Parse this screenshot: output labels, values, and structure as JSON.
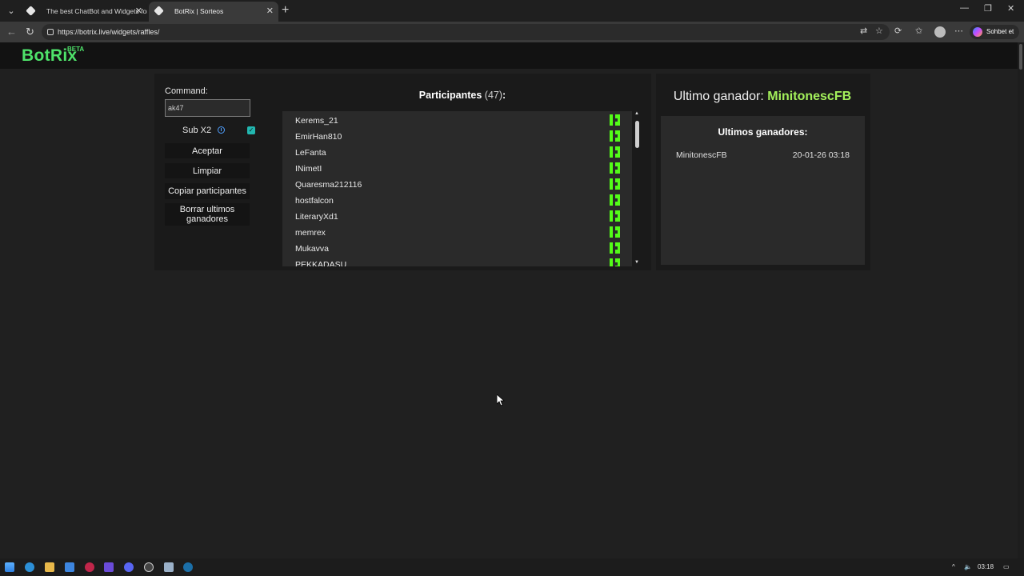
{
  "browser": {
    "tabs": [
      {
        "title": "The best ChatBot and Widgets for"
      },
      {
        "title": "BotRix | Sorteos"
      }
    ],
    "url": "https://botrix.live/widgets/raffles/",
    "copilot_label": "Sohbet et"
  },
  "site": {
    "logo": "BotRix",
    "logo_badge": "BETA"
  },
  "controls": {
    "command_label": "Command:",
    "command_value": "ak47",
    "sub_label": "Sub X2",
    "sub_checked": true,
    "accept": "Aceptar",
    "clear": "Limpiar",
    "copy": "Copiar participantes",
    "delete_winners": "Borrar ultimos ganadores"
  },
  "participants": {
    "title": "Participantes",
    "count": "(47)",
    "suffix": ":",
    "items": [
      "Kerems_21",
      "EmirHan810",
      "LeFanta",
      "INimetI",
      "Quaresma212116",
      "hostfalcon",
      "LiteraryXd1",
      "memrex",
      "Mukavva",
      "PEKKADASU"
    ],
    "platform_icon": "kick-icon",
    "platform_color": "#53fc18"
  },
  "winners": {
    "last_label": "Ultimo ganador:",
    "last_name": "MinitonescFB",
    "list_title": "Ultimos ganadores:",
    "list": [
      {
        "name": "MinitonescFB",
        "date": "20-01-26 03:18"
      }
    ]
  },
  "taskbar": {
    "time": "03:18"
  },
  "colors": {
    "brand": "#4ee36a",
    "winner": "#a3f05b",
    "checkbox": "#22b7b0"
  }
}
